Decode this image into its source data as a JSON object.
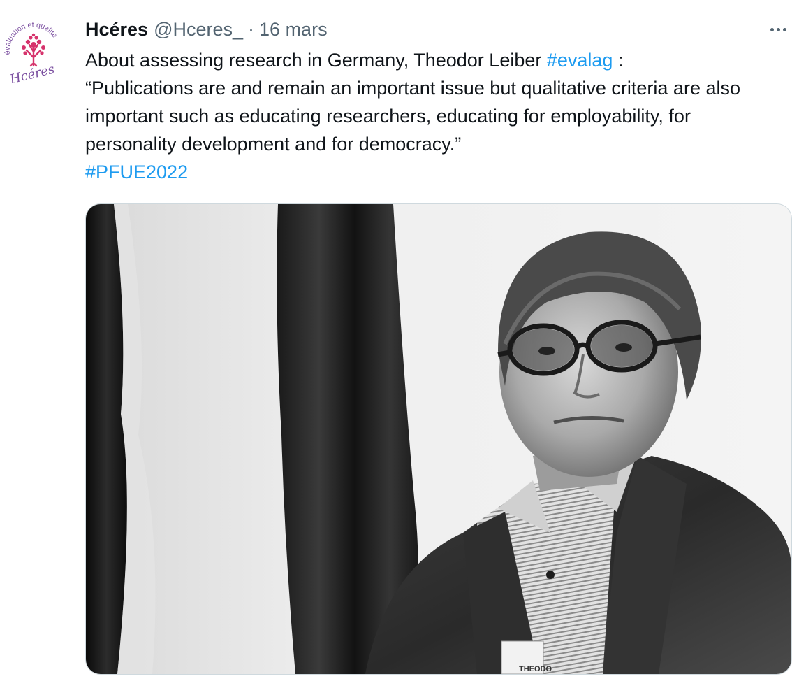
{
  "tweet": {
    "author_name": "Hcéres",
    "handle": "@Hceres_",
    "separator": "·",
    "date": "16 mars",
    "more_icon": "more-horizontal-icon",
    "text_line1_prefix": "About assessing research in Germany, Theodor Leiber ",
    "hashtag1": "#evalag",
    "text_line1_suffix": " :",
    "quote": "“Publications are and remain an important issue but qualitative criteria are also important such as educating researchers, educating for employability, for personality development and for democracy.”",
    "hashtag2": "#PFUE2022"
  },
  "avatar": {
    "logo_text": "Hcéres",
    "arc_text": "évaluation et qualité",
    "colors": {
      "pink": "#d6336c",
      "purple": "#7b4fa0"
    }
  },
  "media": {
    "badge_text": "THEODO"
  },
  "colors": {
    "link": "#1d9bf0",
    "muted": "#536471",
    "text": "#0f1419"
  }
}
